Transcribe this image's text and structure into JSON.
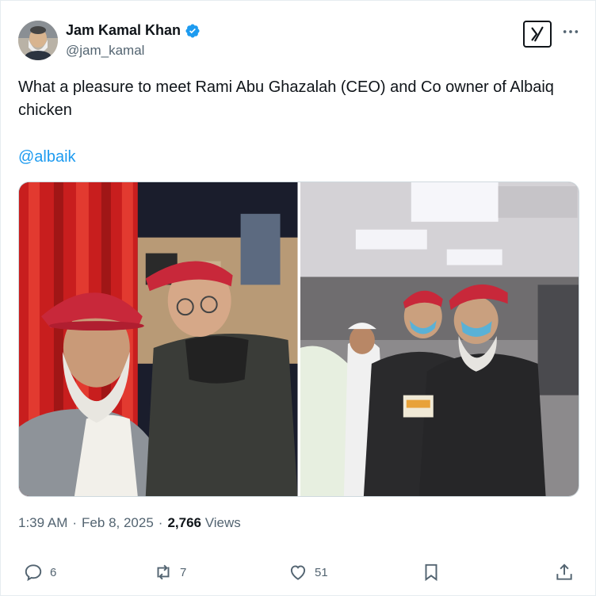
{
  "author": {
    "display_name": "Jam Kamal Khan",
    "handle": "@jam_kamal",
    "verified": true
  },
  "tweet": {
    "text": "What a pleasure to meet Rami Abu Ghazalah (CEO) and Co owner of Albaiq chicken",
    "mention": "@albaik"
  },
  "meta": {
    "time": "1:39 AM",
    "separator1": "·",
    "date": "Feb 8, 2025",
    "separator2": "·",
    "views_count": "2,766",
    "views_label": "Views"
  },
  "actions": {
    "replies": "6",
    "reposts": "7",
    "likes": "51"
  },
  "icons": {
    "verified": "verified-badge-icon",
    "brand": "xai-grok-icon",
    "more": "more-horizontal-icon",
    "reply": "reply-icon",
    "repost": "repost-icon",
    "like": "heart-icon",
    "bookmark": "bookmark-icon",
    "share": "share-icon"
  },
  "colors": {
    "accent": "#1d9bf0",
    "text": "#0f1419",
    "secondary": "#536471"
  }
}
